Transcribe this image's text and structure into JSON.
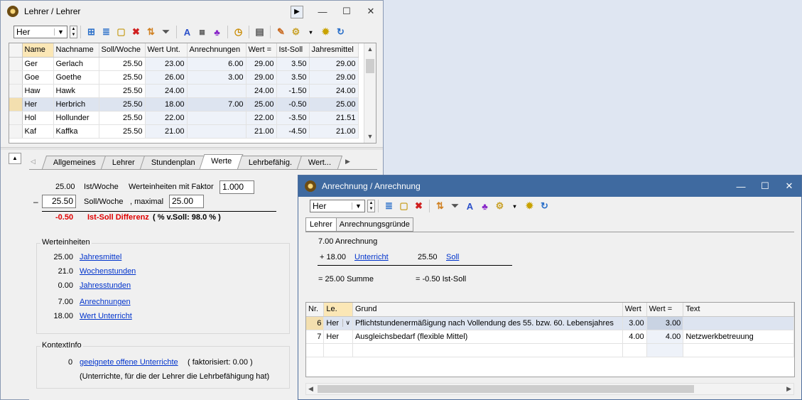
{
  "win1": {
    "title": "Lehrer / Lehrer",
    "combo": "Her",
    "columns": [
      "Name",
      "Nachname",
      "Soll/Woche",
      "Wert Unt.",
      "Anrechnungen",
      "Wert =",
      "Ist-Soll",
      "Jahresmittel"
    ],
    "rows": [
      [
        "Ger",
        "Gerlach",
        "25.50",
        "23.00",
        "6.00",
        "29.00",
        "3.50",
        "29.00"
      ],
      [
        "Goe",
        "Goethe",
        "25.50",
        "26.00",
        "3.00",
        "29.00",
        "3.50",
        "29.00"
      ],
      [
        "Haw",
        "Hawk",
        "25.50",
        "24.00",
        "",
        "24.00",
        "-1.50",
        "24.00"
      ],
      [
        "Her",
        "Herbrich",
        "25.50",
        "18.00",
        "7.00",
        "25.00",
        "-0.50",
        "25.00"
      ],
      [
        "Hol",
        "Hollunder",
        "25.50",
        "22.00",
        "",
        "22.00",
        "-3.50",
        "21.51"
      ],
      [
        "Kaf",
        "Kaffka",
        "25.50",
        "21.00",
        "",
        "21.00",
        "-4.50",
        "21.00"
      ]
    ],
    "tabs": [
      "Allgemeines",
      "Lehrer",
      "Stundenplan",
      "Werte",
      "Lehrbefähig.",
      "Wert..."
    ],
    "werte": {
      "ist_value": "25.00",
      "ist_label": "Ist/Woche",
      "faktor_label": "Werteinheiten mit Faktor",
      "faktor_value": "1.000",
      "minus": "–",
      "soll_value": "25.50",
      "soll_label": "Soll/Woche",
      "max_label": ", maximal",
      "max_value": "25.00",
      "diff_value": "-0.50",
      "diff_label": "Ist-Soll Differenz",
      "percent": "( % v.Soll: 98.0 % )",
      "group_we": "Werteinheiten",
      "we_items": [
        {
          "value": "25.00",
          "label": "Jahresmittel"
        },
        {
          "value": "21.0",
          "label": "Wochenstunden"
        },
        {
          "value": "0.00",
          "label": "Jahresstunden"
        },
        {
          "value": "7.00",
          "label": "Anrechnungen"
        },
        {
          "value": "18.00",
          "label": "Wert Unterricht"
        }
      ],
      "group_ki": "KontextInfo",
      "ki_count": "0",
      "ki_link": "geeignete offene Unterrichte",
      "ki_faktor": "( faktorisiert:  0.00 )",
      "ki_note": "(Unterrichte, für die der Lehrer die Lehrbefähigung hat)"
    }
  },
  "win2": {
    "title": "Anrechnung / Anrechnung",
    "combo": "Her",
    "tabs": [
      "Lehrer",
      "Anrechnungsgründe"
    ],
    "summary": {
      "total": "7.00 Anrechnung",
      "plus": "+ 18.00",
      "unterricht": "Unterricht",
      "soll_value": "25.50",
      "soll_link": "Soll",
      "summe": "= 25.00 Summe",
      "istsoll": "= -0.50 Ist-Soll"
    },
    "columns": [
      "Nr.",
      "Le.",
      "Grund",
      "Wert",
      "Wert =",
      "Text"
    ],
    "rows": [
      [
        "6",
        "Her",
        "Pflichtstundenermäßigung nach Vollendung des 55. bzw. 60. Lebensjahres",
        "3.00",
        "3.00",
        ""
      ],
      [
        "7",
        "Her",
        "Ausgleichsbedarf (flexible Mittel)",
        "4.00",
        "4.00",
        "Netzwerkbetreuung"
      ]
    ]
  }
}
